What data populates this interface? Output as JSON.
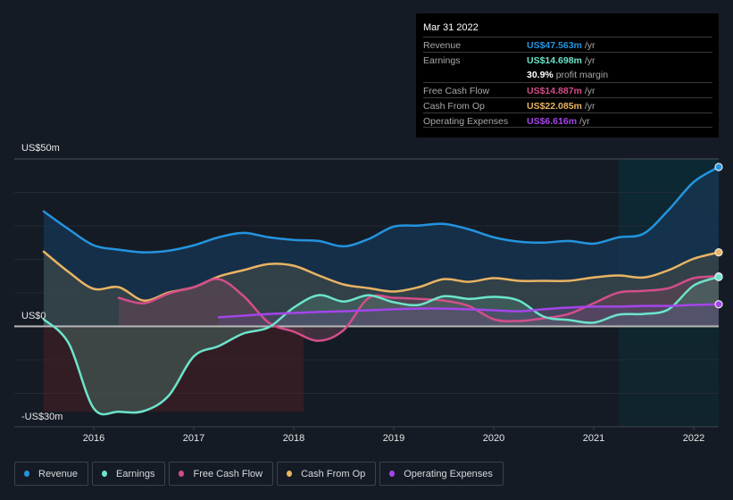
{
  "tooltip": {
    "date": "Mar 31 2022",
    "rows": [
      {
        "label": "Revenue",
        "value": "US$47.563m",
        "unit": "/yr",
        "color": "#2394df"
      },
      {
        "label": "Earnings",
        "value": "US$14.698m",
        "unit": "/yr",
        "color": "#6ce4cb"
      },
      {
        "label": "",
        "value": "30.9%",
        "unit": "profit margin",
        "color": "#ffffff"
      },
      {
        "label": "Free Cash Flow",
        "value": "US$14.887m",
        "unit": "/yr",
        "color": "#d34e8a"
      },
      {
        "label": "Cash From Op",
        "value": "US$22.085m",
        "unit": "/yr",
        "color": "#e9b463"
      },
      {
        "label": "Operating Expenses",
        "value": "US$6.616m",
        "unit": "/yr",
        "color": "#a445ea"
      }
    ]
  },
  "legend": [
    {
      "label": "Revenue",
      "color": "#2394df"
    },
    {
      "label": "Earnings",
      "color": "#6ce4cb"
    },
    {
      "label": "Free Cash Flow",
      "color": "#d34e8a"
    },
    {
      "label": "Cash From Op",
      "color": "#e9b463"
    },
    {
      "label": "Operating Expenses",
      "color": "#a445ea"
    }
  ],
  "chart_data": {
    "type": "area",
    "title": "",
    "xlabel": "",
    "ylabel": "",
    "y_tick_labels": [
      "US$50m",
      "US$0",
      "-US$30m"
    ],
    "ylim": [
      -30,
      50
    ],
    "xlim": [
      2015.49,
      2022.25
    ],
    "x_ticks": [
      2016,
      2017,
      2018,
      2019,
      2020,
      2021,
      2022
    ],
    "x_tick_labels": [
      "2016",
      "2017",
      "2018",
      "2019",
      "2020",
      "2021",
      "2022"
    ],
    "grid": true,
    "forecast_region_start": 2021.25,
    "legend_position": "bottom-left",
    "series": [
      {
        "name": "Revenue",
        "color": "#2394df",
        "x": [
          2015.5,
          2015.75,
          2016.0,
          2016.25,
          2016.5,
          2016.75,
          2017.0,
          2017.25,
          2017.5,
          2017.75,
          2018.0,
          2018.25,
          2018.5,
          2018.75,
          2019.0,
          2019.25,
          2019.5,
          2019.75,
          2020.0,
          2020.25,
          2020.5,
          2020.75,
          2021.0,
          2021.25,
          2021.5,
          2021.75,
          2022.0,
          2022.25
        ],
        "values": [
          34.3,
          29.0,
          24.2,
          22.9,
          22.1,
          22.6,
          24.2,
          26.6,
          27.9,
          26.6,
          25.8,
          25.5,
          23.9,
          26.1,
          29.8,
          30.1,
          30.6,
          29.0,
          26.6,
          25.3,
          25.0,
          25.5,
          24.7,
          26.6,
          27.7,
          34.8,
          43.1,
          47.6
        ]
      },
      {
        "name": "Cash From Op",
        "color": "#e9b463",
        "x": [
          2015.5,
          2015.75,
          2016.0,
          2016.25,
          2016.5,
          2016.75,
          2017.0,
          2017.25,
          2017.5,
          2017.75,
          2018.0,
          2018.25,
          2018.5,
          2018.75,
          2019.0,
          2019.25,
          2019.5,
          2019.75,
          2020.0,
          2020.25,
          2020.5,
          2020.75,
          2021.0,
          2021.25,
          2021.5,
          2021.75,
          2022.0,
          2022.25
        ],
        "values": [
          22.3,
          16.2,
          11.2,
          11.7,
          7.7,
          10.1,
          11.7,
          14.9,
          16.8,
          18.6,
          18.1,
          15.2,
          12.5,
          11.4,
          10.4,
          11.7,
          14.1,
          13.3,
          14.4,
          13.6,
          13.6,
          13.6,
          14.6,
          15.2,
          14.6,
          16.8,
          20.2,
          22.1
        ]
      },
      {
        "name": "Free Cash Flow",
        "color": "#d34e8a",
        "x": [
          2016.25,
          2016.5,
          2016.75,
          2017.0,
          2017.25,
          2017.5,
          2017.75,
          2018.0,
          2018.25,
          2018.5,
          2018.75,
          2019.0,
          2019.25,
          2019.5,
          2019.75,
          2020.0,
          2020.25,
          2020.5,
          2020.75,
          2021.0,
          2021.25,
          2021.5,
          2021.75,
          2022.0,
          2022.25
        ],
        "values": [
          8.5,
          6.9,
          9.8,
          11.7,
          14.1,
          9.0,
          1.1,
          -1.6,
          -4.3,
          -1.1,
          8.5,
          8.5,
          8.2,
          7.7,
          6.1,
          2.1,
          1.6,
          2.4,
          3.7,
          6.9,
          10.1,
          10.6,
          11.4,
          14.4,
          14.9
        ]
      },
      {
        "name": "Earnings",
        "color": "#6ce4cb",
        "x": [
          2015.5,
          2015.75,
          2016.0,
          2016.25,
          2016.5,
          2016.75,
          2017.0,
          2017.25,
          2017.5,
          2017.75,
          2018.0,
          2018.25,
          2018.5,
          2018.75,
          2019.0,
          2019.25,
          2019.5,
          2019.75,
          2020.0,
          2020.25,
          2020.5,
          2020.75,
          2021.0,
          2021.25,
          2021.5,
          2021.75,
          2022.0,
          2022.25
        ],
        "values": [
          2.1,
          -5.1,
          -24.5,
          -25.5,
          -25.3,
          -20.7,
          -9.0,
          -5.9,
          -2.1,
          -0.3,
          5.6,
          9.3,
          7.4,
          9.3,
          7.2,
          6.4,
          9.0,
          8.2,
          8.8,
          7.7,
          2.9,
          1.9,
          1.1,
          3.5,
          3.7,
          5.1,
          12.2,
          14.7
        ]
      },
      {
        "name": "Operating Expenses",
        "color": "#a445ea",
        "x": [
          2017.25,
          2017.5,
          2017.75,
          2018.0,
          2018.25,
          2018.5,
          2018.75,
          2019.0,
          2019.25,
          2019.5,
          2019.75,
          2020.0,
          2020.25,
          2020.5,
          2020.75,
          2021.0,
          2021.25,
          2021.5,
          2021.75,
          2022.0,
          2022.25
        ],
        "values": [
          2.7,
          3.2,
          3.7,
          4.0,
          4.3,
          4.5,
          4.8,
          5.1,
          5.3,
          5.3,
          5.1,
          4.8,
          4.5,
          5.1,
          5.6,
          5.9,
          5.9,
          6.1,
          6.1,
          6.4,
          6.6
        ]
      }
    ]
  }
}
